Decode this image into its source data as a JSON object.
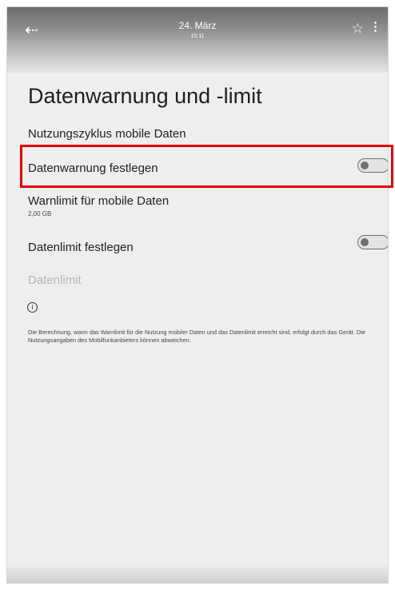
{
  "status_bar": {
    "date": "24. März",
    "time": "15:11",
    "back_icon": "back-arrow-icon",
    "star_icon": "star-icon",
    "more_icon": "more-vertical-icon"
  },
  "page": {
    "title": "Datenwarnung und -limit"
  },
  "settings": {
    "usage_cycle": {
      "label": "Nutzungszyklus mobile Daten"
    },
    "data_warning": {
      "label": "Datenwarnung festlegen",
      "enabled": false
    },
    "warning_limit": {
      "label": "Warnlimit für mobile Daten",
      "value": "2,00 GB"
    },
    "data_limit_toggle": {
      "label": "Datenlimit festlegen",
      "enabled": false
    },
    "data_limit": {
      "label": "Datenlimit",
      "disabled": true
    }
  },
  "info": {
    "icon": "info-icon",
    "text": "Die Berechnung, wann das Warnlimit für die Nutzung mobiler Daten und das Datenlimit erreicht sind, erfolgt durch das Gerät. Die Nutzungsangaben des Mobilfunkanbieters können abweichen."
  },
  "colors": {
    "highlight": "#e00000",
    "background": "#eeeeef"
  }
}
